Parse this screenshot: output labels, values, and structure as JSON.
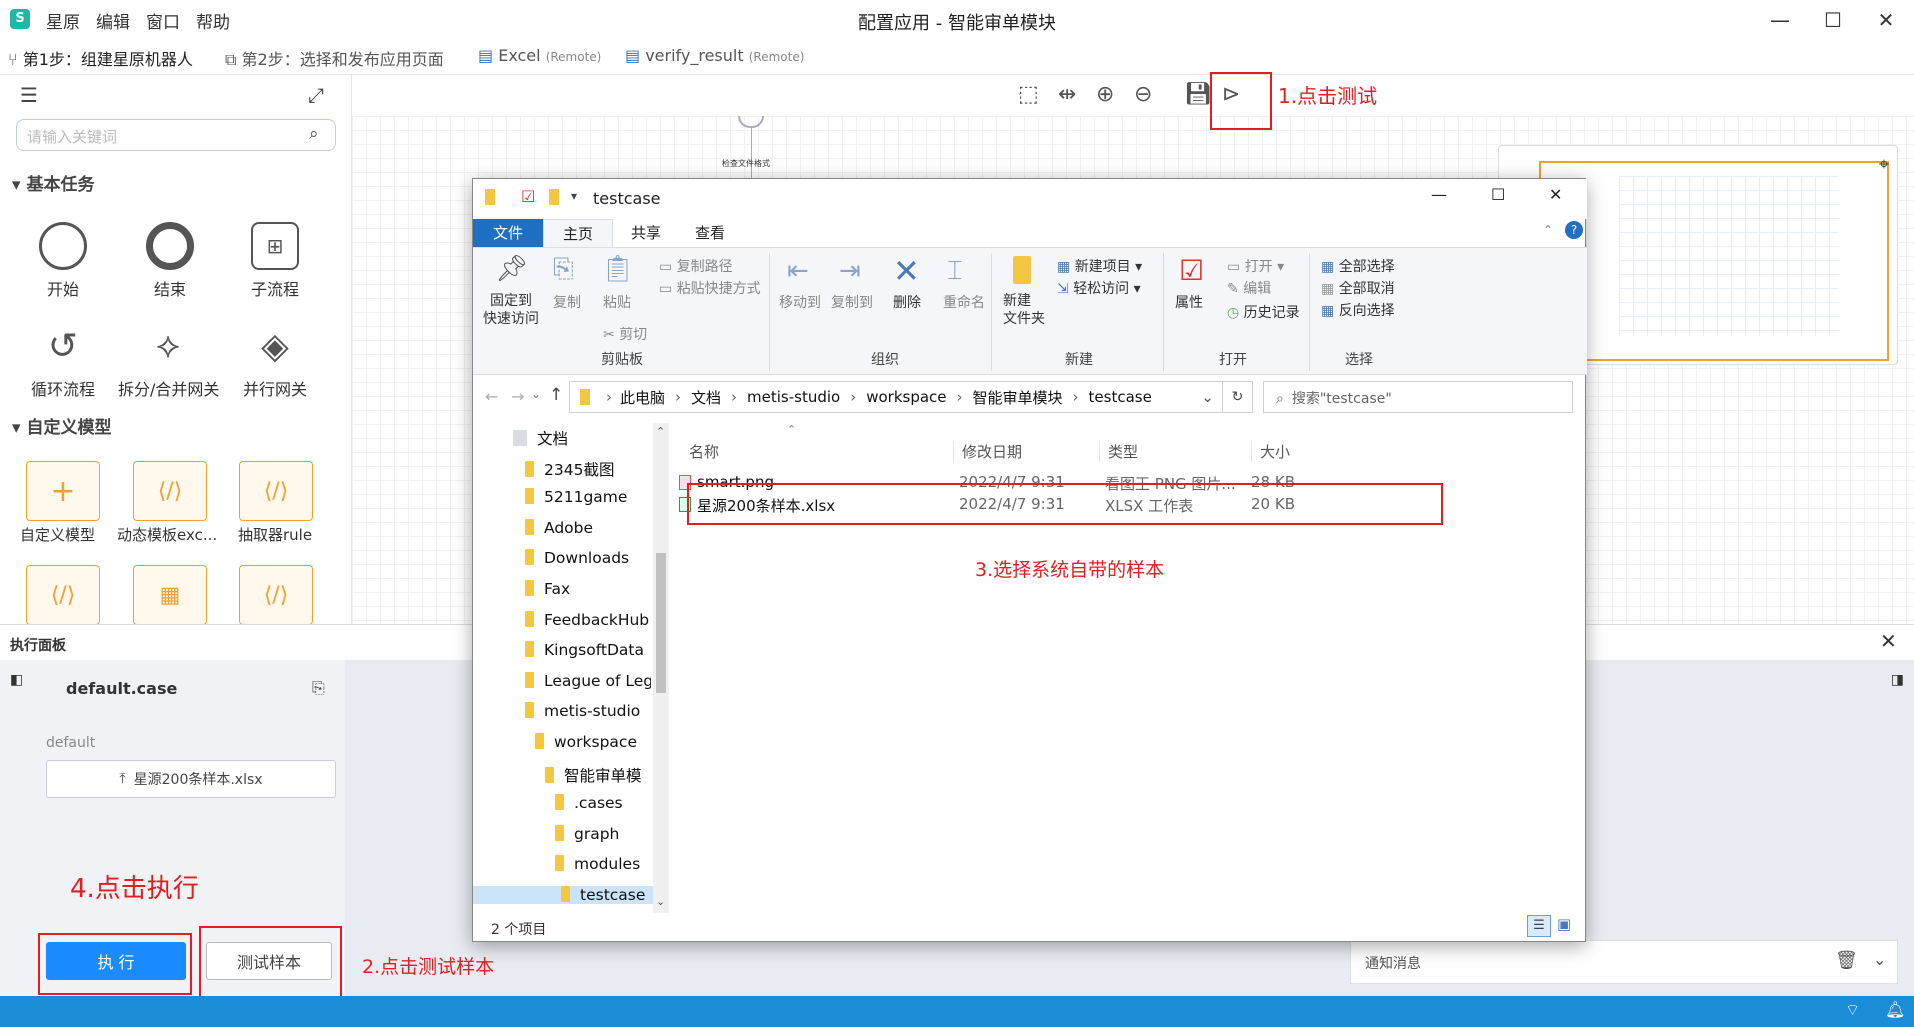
{
  "app": {
    "menu": [
      "星原",
      "编辑",
      "窗口",
      "帮助"
    ],
    "title": "配置应用 - 智能审单模块",
    "window_buttons": [
      "—",
      "☐",
      "✕"
    ]
  },
  "tabs": [
    {
      "label": "第1步：组建星原机器人",
      "remote": ""
    },
    {
      "label": "第2步：选择和发布应用页面",
      "remote": ""
    },
    {
      "label": "Excel",
      "remote": "(Remote)"
    },
    {
      "label": "verify_result",
      "remote": "(Remote)"
    }
  ],
  "left_panel": {
    "search_placeholder": "请输入关键词",
    "section_basic": "基本任务",
    "basic_nodes": [
      "开始",
      "结束",
      "子流程",
      "循环流程",
      "拆分/合并网关",
      "并行网关"
    ],
    "section_custom": "自定义模型",
    "custom_nodes": [
      "自定义模型",
      "动态模板exc...",
      "抽取器rule"
    ]
  },
  "canvas": {
    "node_label": "检查文件格式"
  },
  "exec_panel": {
    "title": "执行面板",
    "case_name": "default.case",
    "case_sub": "default",
    "upload_file": "星源200条样本.xlsx",
    "run_button": "执 行",
    "sample_button": "测试样本",
    "notify": "通知消息"
  },
  "annotations": {
    "a1": "1.点击测试",
    "a2": "2.点击测试样本",
    "a3": "3.选择系统自带的样本",
    "a4": "4.点击执行"
  },
  "explorer": {
    "title": "testcase",
    "ribbon_tabs": [
      "文件",
      "主页",
      "共享",
      "查看"
    ],
    "ribbon": {
      "pin": "固定到\n快速访问",
      "copy": "复制",
      "paste": "粘贴",
      "copy_path": "复制路径",
      "paste_shortcut": "粘贴快捷方式",
      "cut": "剪切",
      "group_clipboard": "剪贴板",
      "move_to": "移动到",
      "copy_to": "复制到",
      "delete": "删除",
      "rename": "重命名",
      "group_organize": "组织",
      "new_folder": "新建\n文件夹",
      "new_item": "新建项目 ▾",
      "easy_access": "轻松访问 ▾",
      "group_new": "新建",
      "properties": "属性",
      "open": "打开 ▾",
      "edit": "编辑",
      "history": "历史记录",
      "group_open": "打开",
      "select_all": "全部选择",
      "select_none": "全部取消",
      "invert": "反向选择",
      "group_select": "选择"
    },
    "breadcrumb": [
      "此电脑",
      "文档",
      "metis-studio",
      "workspace",
      "智能审单模块",
      "testcase"
    ],
    "search_placeholder": "搜索\"testcase\"",
    "tree": [
      {
        "label": "文档",
        "indent": 0
      },
      {
        "label": "2345截图",
        "indent": 1
      },
      {
        "label": "5211game",
        "indent": 1
      },
      {
        "label": "Adobe",
        "indent": 1
      },
      {
        "label": "Downloads",
        "indent": 1
      },
      {
        "label": "Fax",
        "indent": 1
      },
      {
        "label": "FeedbackHub",
        "indent": 1
      },
      {
        "label": "KingsoftData",
        "indent": 1
      },
      {
        "label": "League of Leg",
        "indent": 1
      },
      {
        "label": "metis-studio",
        "indent": 1
      },
      {
        "label": "workspace",
        "indent": 2
      },
      {
        "label": "智能审单模",
        "indent": 3
      },
      {
        "label": ".cases",
        "indent": 4
      },
      {
        "label": "graph",
        "indent": 4
      },
      {
        "label": "modules",
        "indent": 4
      },
      {
        "label": "testcase",
        "indent": 4
      }
    ],
    "columns": [
      "名称",
      "修改日期",
      "类型",
      "大小"
    ],
    "files": [
      {
        "name": "smart.png",
        "date": "2022/4/7 9:31",
        "type": "看图王 PNG 图片...",
        "size": "28 KB",
        "icon": "png-file-icon"
      },
      {
        "name": "星源200条样本.xlsx",
        "date": "2022/4/7 9:31",
        "type": "XLSX 工作表",
        "size": "20 KB",
        "icon": "xlsx-file-icon"
      }
    ],
    "status": "2 个项目"
  },
  "colors": {
    "accent": "#1a8cff",
    "statusbar": "#1a8cd8",
    "annotation_red": "#e02020",
    "node_orange": "#f0a030",
    "ribbon_file_tab": "#1f6fc4"
  }
}
